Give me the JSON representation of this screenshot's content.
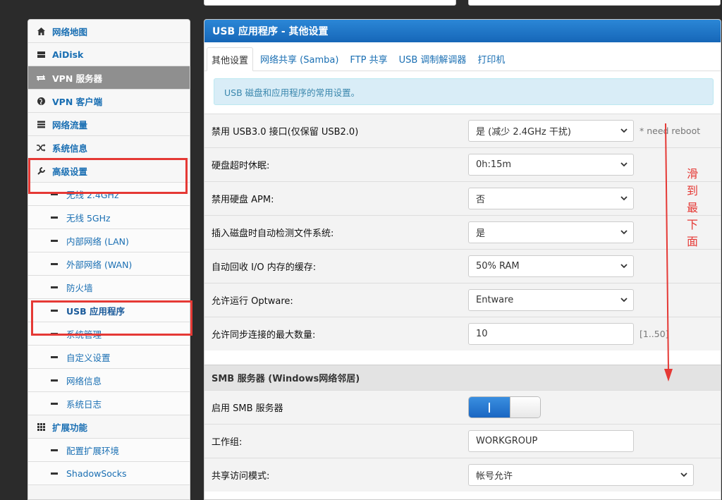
{
  "sidebar": {
    "items": [
      {
        "label": "网络地图",
        "icon": "home-icon"
      },
      {
        "label": "AiDisk",
        "icon": "hdd-icon"
      },
      {
        "label": "VPN 服务器",
        "icon": "vpn-server-icon",
        "active": true
      },
      {
        "label": "VPN 客户端",
        "icon": "globe-icon"
      },
      {
        "label": "网络流量",
        "icon": "traffic-icon"
      },
      {
        "label": "系统信息",
        "icon": "shuffle-icon"
      },
      {
        "label": "高级设置",
        "icon": "wrench-icon"
      }
    ],
    "subitems": [
      "无线 2.4GHz",
      "无线 5GHz",
      "内部网络 (LAN)",
      "外部网络 (WAN)",
      "防火墙",
      "USB 应用程序",
      "系统管理",
      "自定义设置",
      "网络信息",
      "系统日志"
    ],
    "ext": {
      "label": "扩展功能",
      "icon": "grid-icon"
    },
    "ext_subitems": [
      "配置扩展环境",
      "ShadowSocks"
    ]
  },
  "main": {
    "title": "USB 应用程序 - 其他设置",
    "tabs": [
      "其他设置",
      "网络共享 (Samba)",
      "FTP 共享",
      "USB 调制解调器",
      "打印机"
    ],
    "info": "USB 磁盘和应用程序的常用设置。",
    "rows": [
      {
        "label": "禁用 USB3.0 接口(仅保留 USB2.0)",
        "value": "是 (减少 2.4GHz 干扰)",
        "hint": "* need reboot"
      },
      {
        "label": "硬盘超时休眠:",
        "value": "0h:15m"
      },
      {
        "label": "禁用硬盘 APM:",
        "value": "否"
      },
      {
        "label": "插入磁盘时自动检测文件系统:",
        "value": "是"
      },
      {
        "label": "自动回收 I/O 内存的缓存:",
        "value": "50% RAM"
      },
      {
        "label": "允许运行 Optware:",
        "value": "Entware"
      },
      {
        "label": "允许同步连接的最大数量:",
        "value": "10",
        "hint": "[1..50]"
      }
    ],
    "smb_section": "SMB 服务器 (Windows网络邻居)",
    "smb_rows": [
      {
        "label": "启用 SMB 服务器",
        "toggle": "on"
      },
      {
        "label": "工作组:",
        "value": "WORKGROUP"
      },
      {
        "label": "共享访问模式:",
        "value": "帐号允许"
      }
    ]
  },
  "annotation": {
    "text": [
      "滑",
      "到",
      "最",
      "下",
      "面"
    ],
    "color": "#e53935"
  }
}
